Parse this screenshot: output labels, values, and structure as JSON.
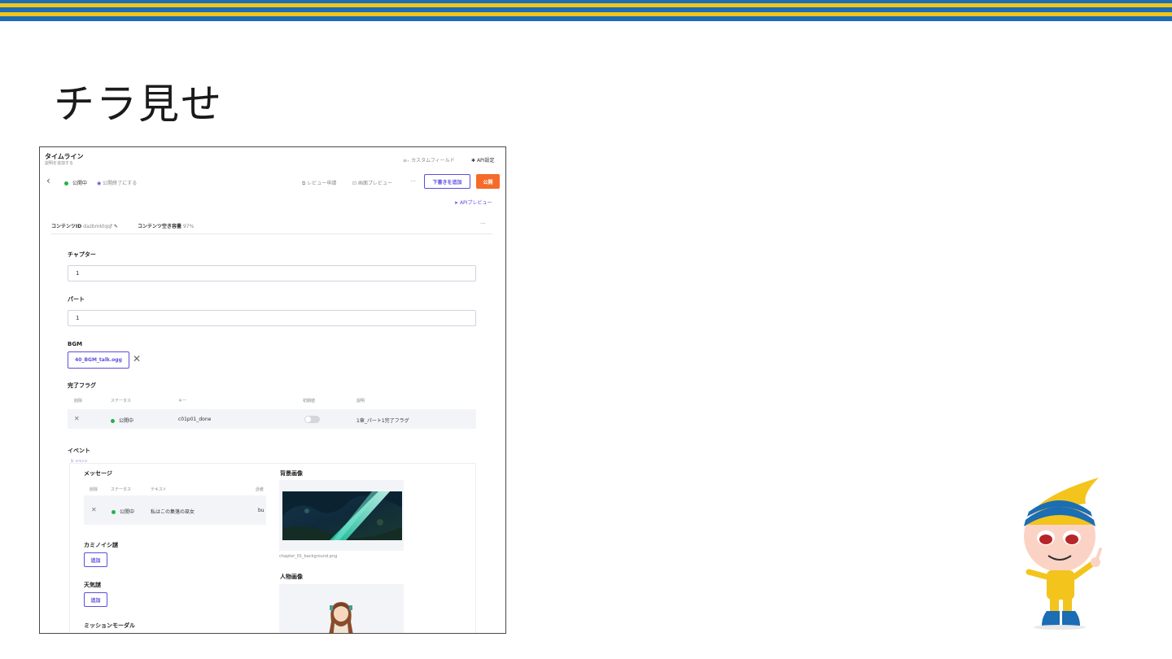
{
  "slide": {
    "title": "チラ見せ"
  },
  "header": {
    "title": "タイムライン",
    "subtitle": "説明を追加する",
    "custom_field": "カスタムフィールド",
    "api_settings": "API設定"
  },
  "toolbar": {
    "status": "公開中",
    "end_publish": "公開終了にする",
    "review": "レビュー申請",
    "preview": "画面プレビュー",
    "more": "···",
    "add_draft": "下書きを追加",
    "publish": "公開",
    "api_preview": "APIプレビュー"
  },
  "meta": {
    "content_id_label": "コンテンツID",
    "content_id": "dazbmktqqf",
    "capacity_label": "コンテンツ空き容量",
    "capacity": "97%",
    "more": "···"
  },
  "form": {
    "chapter_label": "チャプター",
    "chapter_value": "1",
    "part_label": "パート",
    "part_value": "1",
    "bgm_label": "BGM",
    "bgm_file": "40_BGM_talk.ogg",
    "flag_label": "完了フラグ",
    "flag_headers": [
      "削除",
      "ステータス",
      "キー",
      "初期値",
      "説明"
    ],
    "flag_row": {
      "status": "公開中",
      "key": "c01p01_done",
      "description": "1章_パート1完了フラグ"
    },
    "event_label": "イベント",
    "event_tag": "1: イベント",
    "message_label": "メッセージ",
    "message_headers": [
      "削除",
      "ステータス",
      "テキスト",
      "話者"
    ],
    "message_row": {
      "status": "公開中",
      "text": "私はこの集落の巫女",
      "speaker": "bu"
    },
    "bg_label": "背景画像",
    "bg_file": "chapter_01_background.png",
    "person_label": "人物画像",
    "kamino_label": "カミノイシ謎",
    "kamino_add": "追加",
    "weather_label": "天気謎",
    "weather_add": "追加",
    "mission_label": "ミッションモーダル"
  },
  "colors": {
    "accent": "#5b4ee0",
    "publish": "#f56b2a",
    "status_green": "#22b34a",
    "stripe_blue": "#1b6db4",
    "stripe_yellow": "#f3c41b"
  }
}
